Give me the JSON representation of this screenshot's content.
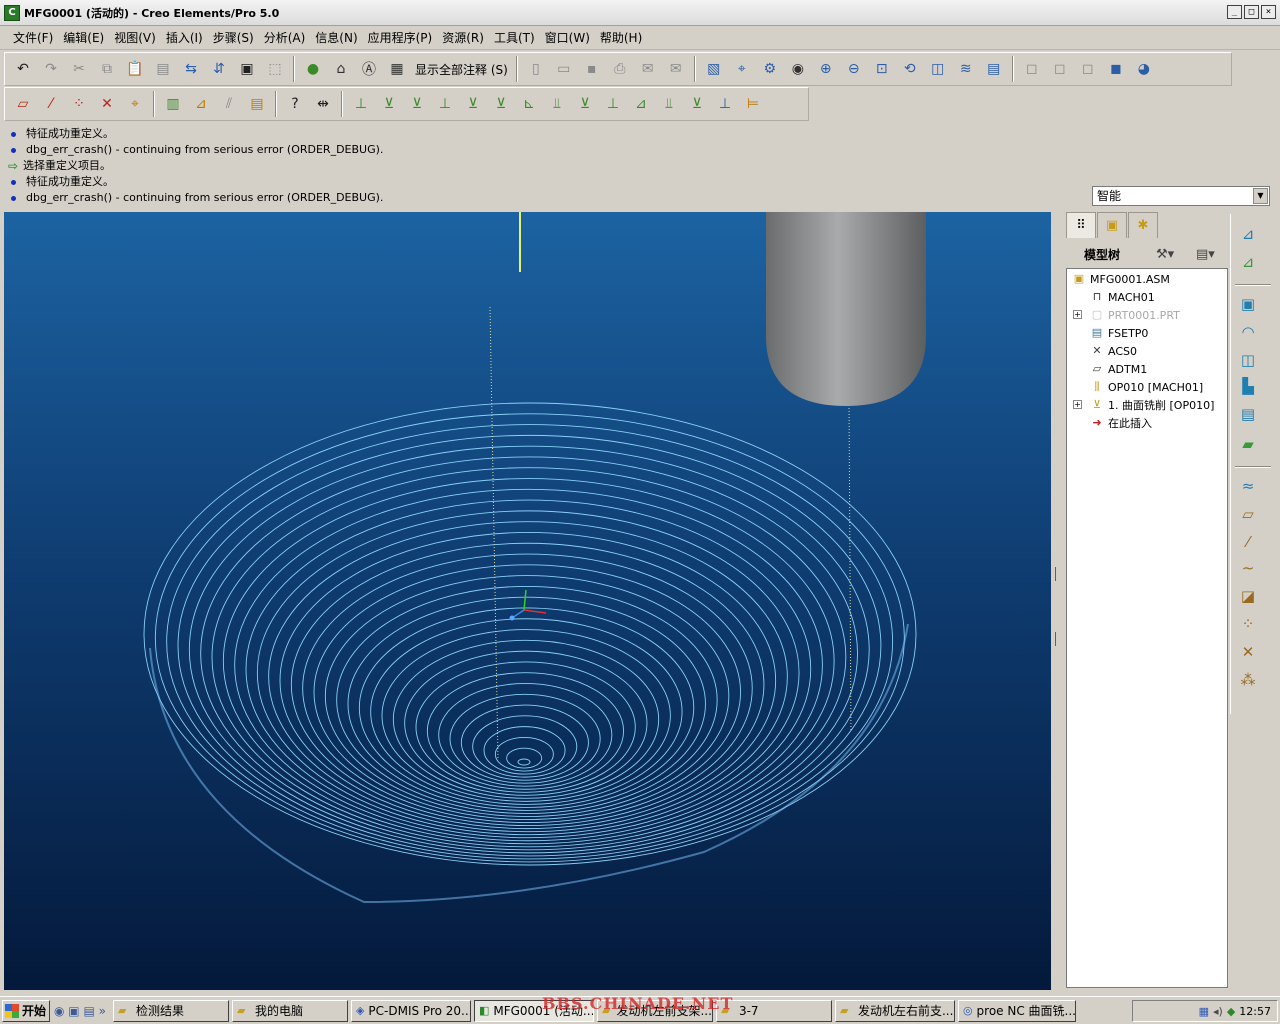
{
  "window": {
    "title": "MFG0001 (活动的) - Creo Elements/Pro 5.0"
  },
  "menu": [
    "文件(F)",
    "编辑(E)",
    "视图(V)",
    "插入(I)",
    "步骤(S)",
    "分析(A)",
    "信息(N)",
    "应用程序(P)",
    "资源(R)",
    "工具(T)",
    "窗口(W)",
    "帮助(H)"
  ],
  "toolbar": {
    "show_annotations_label": "显示全部注释 (S)"
  },
  "messages": [
    {
      "type": "info",
      "text": "特征成功重定义。"
    },
    {
      "type": "info",
      "text": "dbg_err_crash() - continuing from serious error (ORDER_DEBUG)."
    },
    {
      "type": "prompt",
      "text": "选择重定义项目。"
    },
    {
      "type": "info",
      "text": "特征成功重定义。"
    },
    {
      "type": "info",
      "text": "dbg_err_crash() - continuing from serious error (ORDER_DEBUG)."
    }
  ],
  "filter": {
    "selected": "智能"
  },
  "model_tree": {
    "header": "模型树",
    "items": [
      {
        "label": "MFG0001.ASM",
        "icon": "assembly-icon"
      },
      {
        "label": "MACH01",
        "icon": "machine-icon"
      },
      {
        "label": "PRT0001.PRT",
        "icon": "part-icon",
        "dim": true,
        "expandable": true
      },
      {
        "label": "FSETP0",
        "icon": "fixture-icon"
      },
      {
        "label": "ACS0",
        "icon": "coordinate-system-icon"
      },
      {
        "label": "ADTM1",
        "icon": "datum-plane-icon"
      },
      {
        "label": "OP010 [MACH01]",
        "icon": "operation-icon"
      },
      {
        "label": "1. 曲面铣削 [OP010]",
        "icon": "surface-milling-icon",
        "expandable": true
      },
      {
        "label": "在此插入",
        "icon": "insert-here-arrow-icon"
      }
    ]
  },
  "taskbar": {
    "start_label": "开始",
    "tasks": [
      {
        "label": "检测结果",
        "icon": "folder-icon"
      },
      {
        "label": "我的电脑",
        "icon": "folder-icon"
      },
      {
        "label": "PC-DMIS Pro 20...",
        "icon": "app-icon"
      },
      {
        "label": "MFG0001 (活动...",
        "icon": "creo-icon",
        "active": true
      },
      {
        "label": "发动机左前支架...",
        "icon": "folder-icon"
      },
      {
        "label": "3-7",
        "icon": "folder-icon"
      },
      {
        "label": "发动机左右前支...",
        "icon": "folder-icon"
      },
      {
        "label": "proe NC 曲面铣...",
        "icon": "browser-icon"
      }
    ],
    "clock": "12:57"
  },
  "watermark": "BBS.CHINADE.NET",
  "colors": {
    "viewport_top": "#1c63a2",
    "viewport_bottom": "#04193b",
    "toolpath": "#7fd0ff",
    "tool": "#9a9c9e"
  }
}
